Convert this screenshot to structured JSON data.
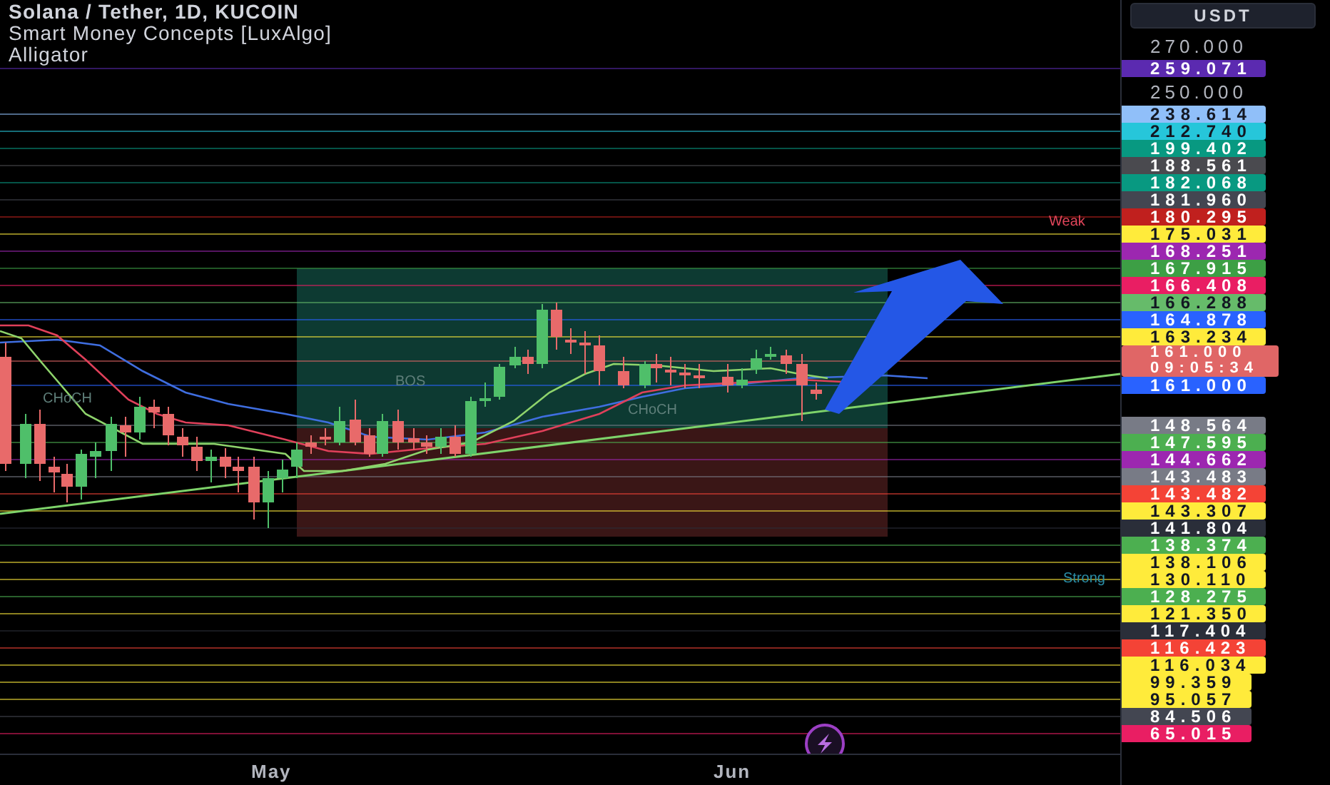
{
  "legend": {
    "symbol": "Solana / Tether, 1D, KUCOIN",
    "indicators": [
      "Smart Money Concepts [LuxAlgo]",
      "Alligator"
    ]
  },
  "chart_labels": [
    {
      "text": "Weak",
      "kind": "weak"
    },
    {
      "text": "Strong",
      "kind": "strong"
    },
    {
      "text": "CHoCH",
      "kind": "structure"
    },
    {
      "text": "BOS",
      "kind": "structure"
    },
    {
      "text": "CHoCH",
      "kind": "structure"
    }
  ],
  "time_axis": [
    "May",
    "Jun"
  ],
  "price_scale": {
    "currency": "USDT",
    "upper": [
      {
        "text": "270.000",
        "kind": "tick"
      },
      {
        "text": "259.071",
        "kind": "label",
        "color": "#5b2ab0"
      },
      {
        "text": "250.000",
        "kind": "tick"
      },
      {
        "text": "238.614",
        "kind": "label",
        "color": "#90bff9"
      },
      {
        "text": "212.740",
        "kind": "label",
        "color": "#26c6da"
      },
      {
        "text": "199.402",
        "kind": "label",
        "color": "#089981"
      },
      {
        "text": "188.561",
        "kind": "label",
        "color": "#4a4a4f"
      },
      {
        "text": "182.068",
        "kind": "label",
        "color": "#089981"
      },
      {
        "text": "181.960",
        "kind": "label",
        "color": "#434651"
      },
      {
        "text": "180.295",
        "kind": "label",
        "color": "#c0201e"
      },
      {
        "text": "175.031",
        "kind": "label",
        "color": "#ffeb3b"
      },
      {
        "text": "168.251",
        "kind": "label",
        "color": "#9c27b0"
      },
      {
        "text": "167.915",
        "kind": "label",
        "color": "#3d9f45"
      },
      {
        "text": "166.408",
        "kind": "label",
        "color": "#e91e63"
      },
      {
        "text": "166.288",
        "kind": "label",
        "color": "#66bb6a"
      },
      {
        "text": "164.878",
        "kind": "label",
        "color": "#2962ff"
      },
      {
        "text": "163.234",
        "kind": "label",
        "color": "#ffeb3b"
      },
      {
        "text": "161.000",
        "kind": "last",
        "countdown": "09:05:34",
        "color": "#e06666"
      },
      {
        "text": "161.000",
        "kind": "label",
        "color": "#2962ff"
      }
    ],
    "lower": [
      {
        "text": "148.564",
        "kind": "label",
        "color": "#787b86"
      },
      {
        "text": "147.595",
        "kind": "label",
        "color": "#4caf50"
      },
      {
        "text": "144.662",
        "kind": "label",
        "color": "#9c27b0"
      },
      {
        "text": "143.483",
        "kind": "label",
        "color": "#787b86"
      },
      {
        "text": "143.482",
        "kind": "label",
        "color": "#f44336"
      },
      {
        "text": "143.307",
        "kind": "label",
        "color": "#ffeb3b"
      },
      {
        "text": "141.804",
        "kind": "label",
        "color": "#2a2e39"
      },
      {
        "text": "138.374",
        "kind": "label",
        "color": "#4caf50"
      },
      {
        "text": "138.106",
        "kind": "label",
        "color": "#ffeb3b"
      },
      {
        "text": "130.110",
        "kind": "label",
        "color": "#ffeb3b"
      },
      {
        "text": "128.275",
        "kind": "label",
        "color": "#4caf50"
      },
      {
        "text": "121.350",
        "kind": "label",
        "color": "#ffeb3b"
      },
      {
        "text": "117.404",
        "kind": "label",
        "color": "#2a2e39"
      },
      {
        "text": "116.423",
        "kind": "label",
        "color": "#f44336"
      },
      {
        "text": "116.034",
        "kind": "label",
        "color": "#ffeb3b"
      },
      {
        "text": "99.359",
        "kind": "label",
        "color": "#ffeb3b"
      },
      {
        "text": "95.057",
        "kind": "label",
        "color": "#ffeb3b"
      },
      {
        "text": "84.506",
        "kind": "label",
        "color": "#434651"
      },
      {
        "text": "65.015",
        "kind": "label",
        "color": "#e91e63"
      }
    ]
  }
}
